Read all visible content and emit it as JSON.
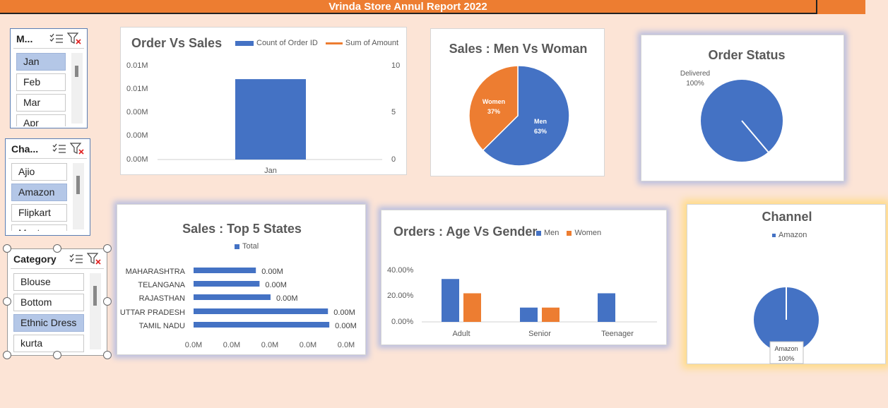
{
  "header": {
    "title": "Vrinda Store Annul Report 2022"
  },
  "colors": {
    "accent": "#ed7d31",
    "blue": "#4472c4",
    "orange": "#ed7d31",
    "background": "#fce4d6",
    "selected": "#b4c7e7"
  },
  "slicers": {
    "month": {
      "title": "M...",
      "items": [
        "Jan",
        "Feb",
        "Mar",
        "Apr"
      ],
      "selected": [
        "Jan"
      ]
    },
    "channel": {
      "title": "Cha...",
      "items": [
        "Ajio",
        "Amazon",
        "Flipkart",
        "Myntra"
      ],
      "selected": [
        "Amazon"
      ]
    },
    "category": {
      "title": "Category",
      "items": [
        "Blouse",
        "Bottom",
        "Ethnic Dress",
        "kurta"
      ],
      "selected": [
        "Ethnic Dress"
      ]
    }
  },
  "icons": {
    "multiselect": "multi-select-icon",
    "clear_filter": "clear-filter-icon"
  },
  "charts": {
    "order_vs_sales": {
      "title": "Order Vs Sales",
      "legend": [
        "Count of Order ID",
        "Sum of Amount"
      ],
      "y_left_ticks": [
        "0.01M",
        "0.01M",
        "0.00M",
        "0.00M",
        "0.00M"
      ],
      "y_right_ticks": [
        "10",
        "5",
        "0"
      ],
      "categories": [
        "Jan"
      ]
    },
    "men_vs_woman": {
      "title": "Sales : Men Vs Woman",
      "slices": [
        {
          "label": "Men",
          "pct": "63%"
        },
        {
          "label": "Women",
          "pct": "37%"
        }
      ]
    },
    "order_status": {
      "title": "Order Status",
      "slices": [
        {
          "label": "Delivered",
          "pct": "100%"
        }
      ]
    },
    "top_states": {
      "title": "Sales : Top 5 States",
      "legend": "Total",
      "states": [
        "MAHARASHTRA",
        "TELANGANA",
        "RAJASTHAN",
        "UTTAR PRADESH",
        "TAMIL NADU"
      ],
      "value_labels": [
        "0.00M",
        "0.00M",
        "0.00M",
        "0.00M",
        "0.00M"
      ],
      "x_ticks": [
        "0.0M",
        "0.0M",
        "0.0M",
        "0.0M",
        "0.0M"
      ]
    },
    "age_vs_gender": {
      "title": "Orders : Age Vs Gender",
      "legend": [
        "Men",
        "Women"
      ],
      "y_ticks": [
        "40.00%",
        "20.00%",
        "0.00%"
      ],
      "categories": [
        "Adult",
        "Senior",
        "Teenager"
      ]
    },
    "channel": {
      "title": "Channel",
      "legend": "Amazon",
      "slices": [
        {
          "label": "Amazon",
          "pct": "100%"
        }
      ]
    }
  },
  "chart_data": [
    {
      "type": "bar",
      "title": "Order Vs Sales",
      "categories": [
        "Jan"
      ],
      "series": [
        {
          "name": "Count of Order ID",
          "values": [
            8.5
          ]
        },
        {
          "name": "Sum of Amount",
          "values": [
            0
          ]
        }
      ],
      "ylim_right": [
        0,
        10
      ]
    },
    {
      "type": "pie",
      "title": "Sales : Men Vs Woman",
      "categories": [
        "Men",
        "Women"
      ],
      "values": [
        63,
        37
      ]
    },
    {
      "type": "pie",
      "title": "Order Status",
      "categories": [
        "Delivered"
      ],
      "values": [
        100
      ]
    },
    {
      "type": "bar",
      "title": "Sales : Top 5 States",
      "categories": [
        "MAHARASHTRA",
        "TELANGANA",
        "RAJASTHAN",
        "UTTAR PRADESH",
        "TAMIL NADU"
      ],
      "series": [
        {
          "name": "Total",
          "values": [
            0.000459,
            0.000486,
            0.000567,
            0.00099,
            0.001
          ]
        }
      ]
    },
    {
      "type": "bar",
      "title": "Orders : Age Vs Gender",
      "categories": [
        "Adult",
        "Senior",
        "Teenager"
      ],
      "series": [
        {
          "name": "Men",
          "values": [
            33.3,
            11.1,
            22.2
          ]
        },
        {
          "name": "Women",
          "values": [
            22.2,
            11.1,
            0
          ]
        }
      ],
      "ylim": [
        0,
        40
      ]
    },
    {
      "type": "pie",
      "title": "Channel",
      "categories": [
        "Amazon"
      ],
      "values": [
        100
      ]
    }
  ]
}
